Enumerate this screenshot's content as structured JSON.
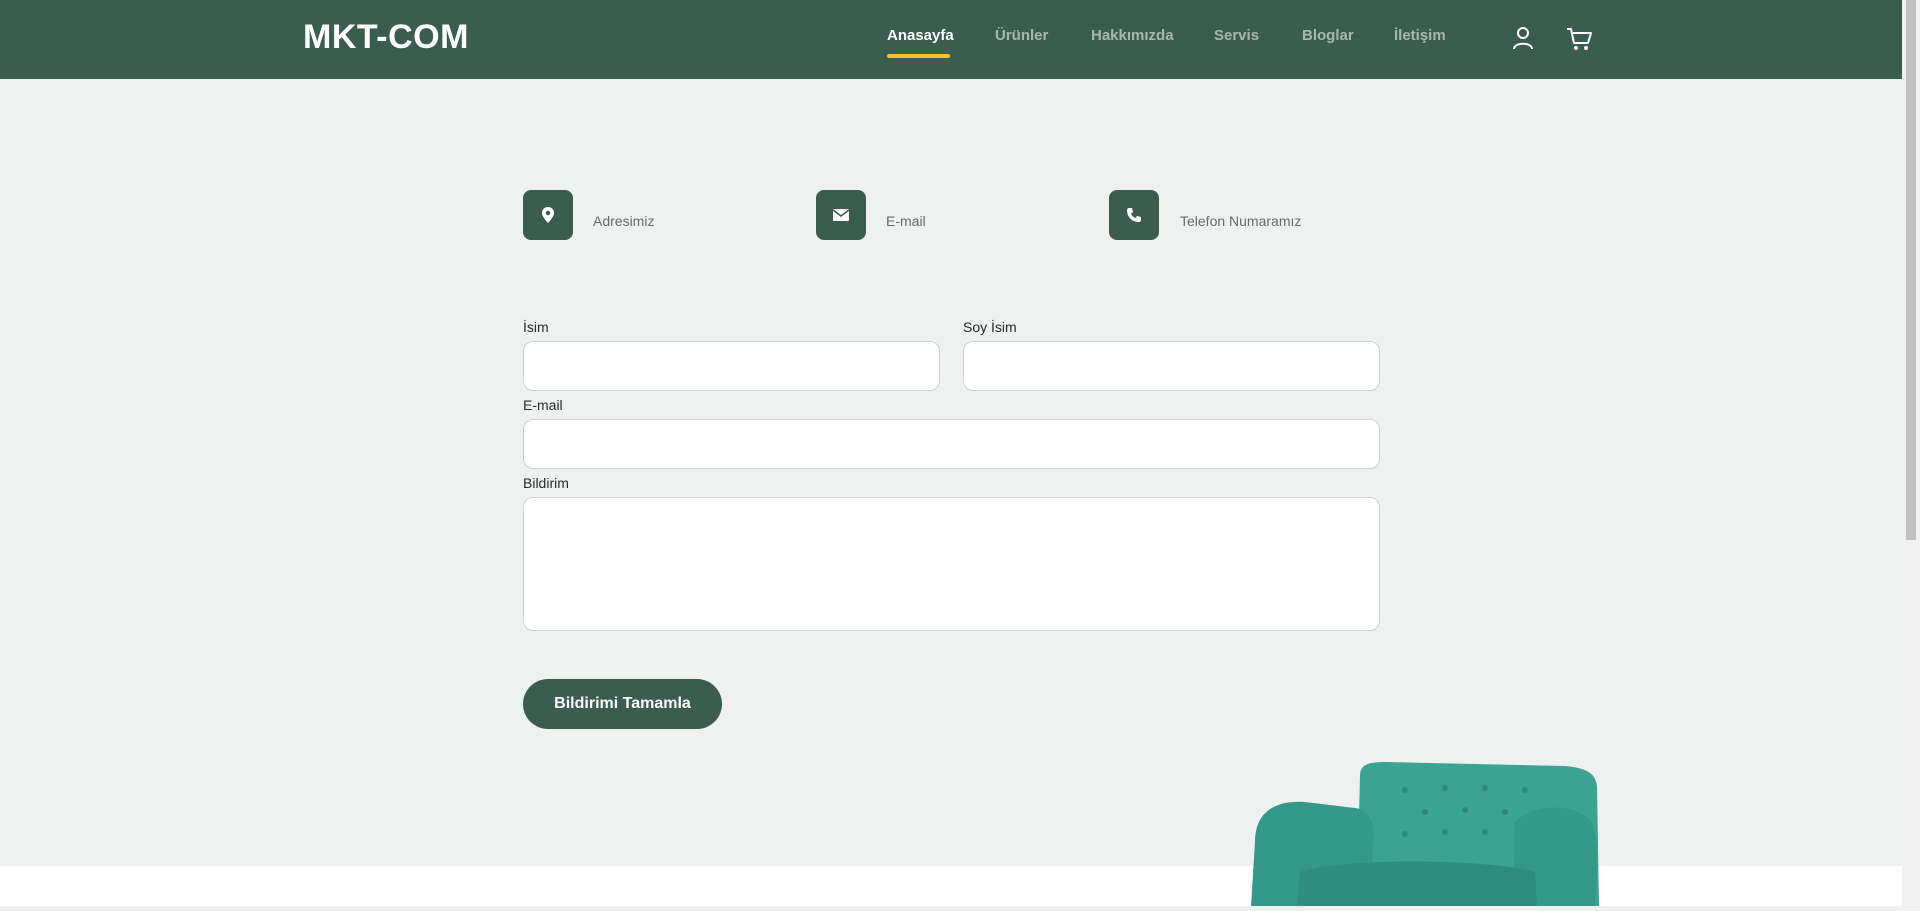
{
  "header": {
    "brand": "MKT-COM",
    "nav": [
      "Anasayfa",
      "Ürünler",
      "Hakkımızda",
      "Servis",
      "Bloglar",
      "İletişim"
    ],
    "active_nav": "Anasayfa",
    "icons": [
      "user-icon",
      "cart-icon"
    ]
  },
  "contact_info": {
    "address_label": "Adresimiz",
    "email_label": "E-mail",
    "phone_label": "Telefon Numaramız",
    "icons": [
      "location-pin-icon",
      "envelope-icon",
      "phone-icon"
    ]
  },
  "form": {
    "first_name_label": "İsim",
    "last_name_label": "Soy İsim",
    "email_label": "E-mail",
    "message_label": "Bildirim",
    "first_name_value": "",
    "last_name_value": "",
    "email_value": "",
    "message_value": "",
    "submit_label": "Bildirimi Tamamla"
  },
  "colors": {
    "primary": "#3b5d50",
    "accent": "#f9bf29",
    "background": "#eff1f0",
    "sofa": "#3aa394"
  }
}
